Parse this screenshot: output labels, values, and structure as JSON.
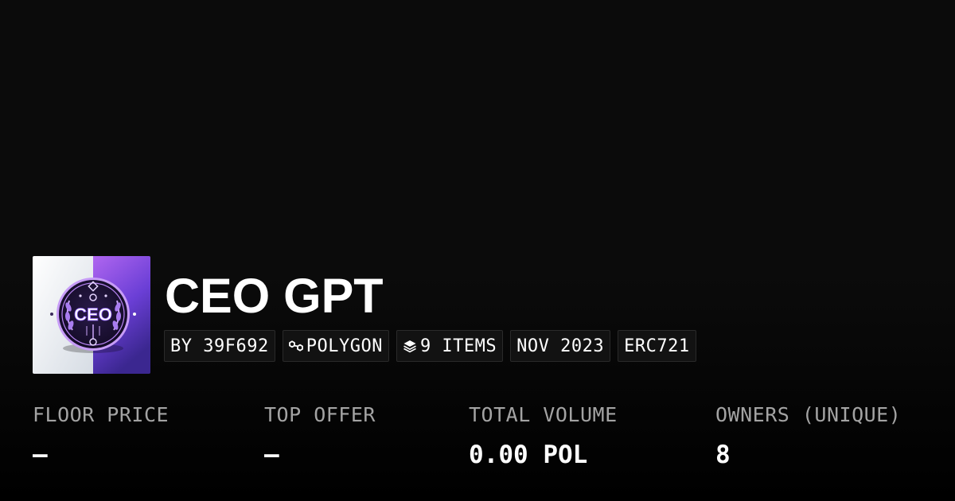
{
  "collection": {
    "title": "CEO GPT",
    "logo_text": "CEO",
    "tags": {
      "creator": "BY 39F692",
      "chain": "POLYGON",
      "chain_icon": "polygon-icon",
      "items": "9 ITEMS",
      "items_icon": "layers-icon",
      "date": "NOV 2023",
      "standard": "ERC721"
    }
  },
  "stats": {
    "floor_price": {
      "label": "FLOOR PRICE",
      "value": "–"
    },
    "top_offer": {
      "label": "TOP OFFER",
      "value": "–"
    },
    "total_volume": {
      "label": "TOTAL VOLUME",
      "value": "0.00 POL"
    },
    "owners": {
      "label": "OWNERS (UNIQUE)",
      "value": "8"
    }
  },
  "colors": {
    "background": "#0b0b0b",
    "text_primary": "#ffffff",
    "text_muted": "#a3a3a3",
    "tag_background": "#121212",
    "logo_purple": "#7c3aed"
  }
}
